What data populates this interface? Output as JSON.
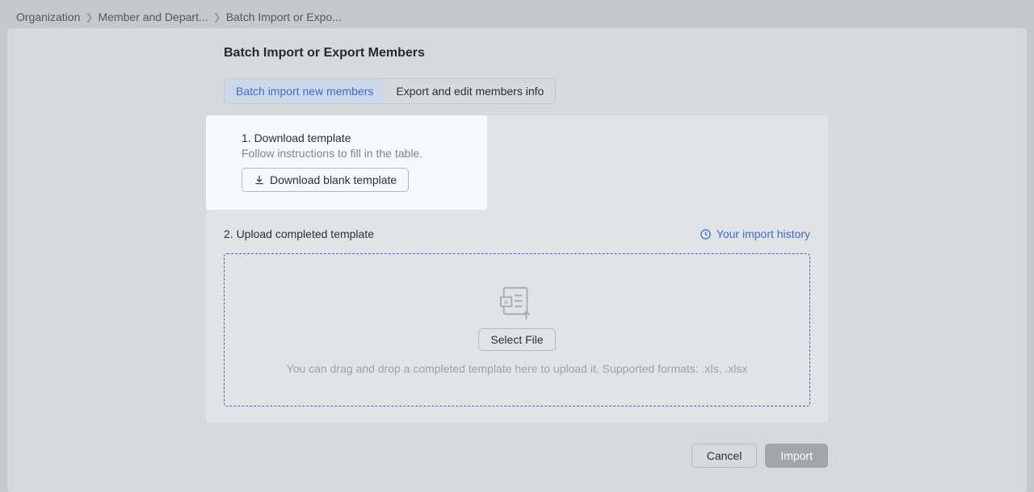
{
  "breadcrumb": {
    "crumb1": "Organization",
    "crumb2": "Member and Depart...",
    "crumb3": "Batch Import or Expo..."
  },
  "page_title": "Batch Import or Export Members",
  "tabs": {
    "import": "Batch import new members",
    "export": "Export and edit members info"
  },
  "step1": {
    "title": "1. Download template",
    "desc": "Follow instructions to fill in the table.",
    "download_label": "Download blank template"
  },
  "step2": {
    "title": "2. Upload completed template",
    "history": "Your import history",
    "select_file": "Select File",
    "hint": "You can drag and drop a completed template here to upload it. Supported formats: .xls, .xlsx"
  },
  "footer": {
    "cancel": "Cancel",
    "import": "Import"
  }
}
